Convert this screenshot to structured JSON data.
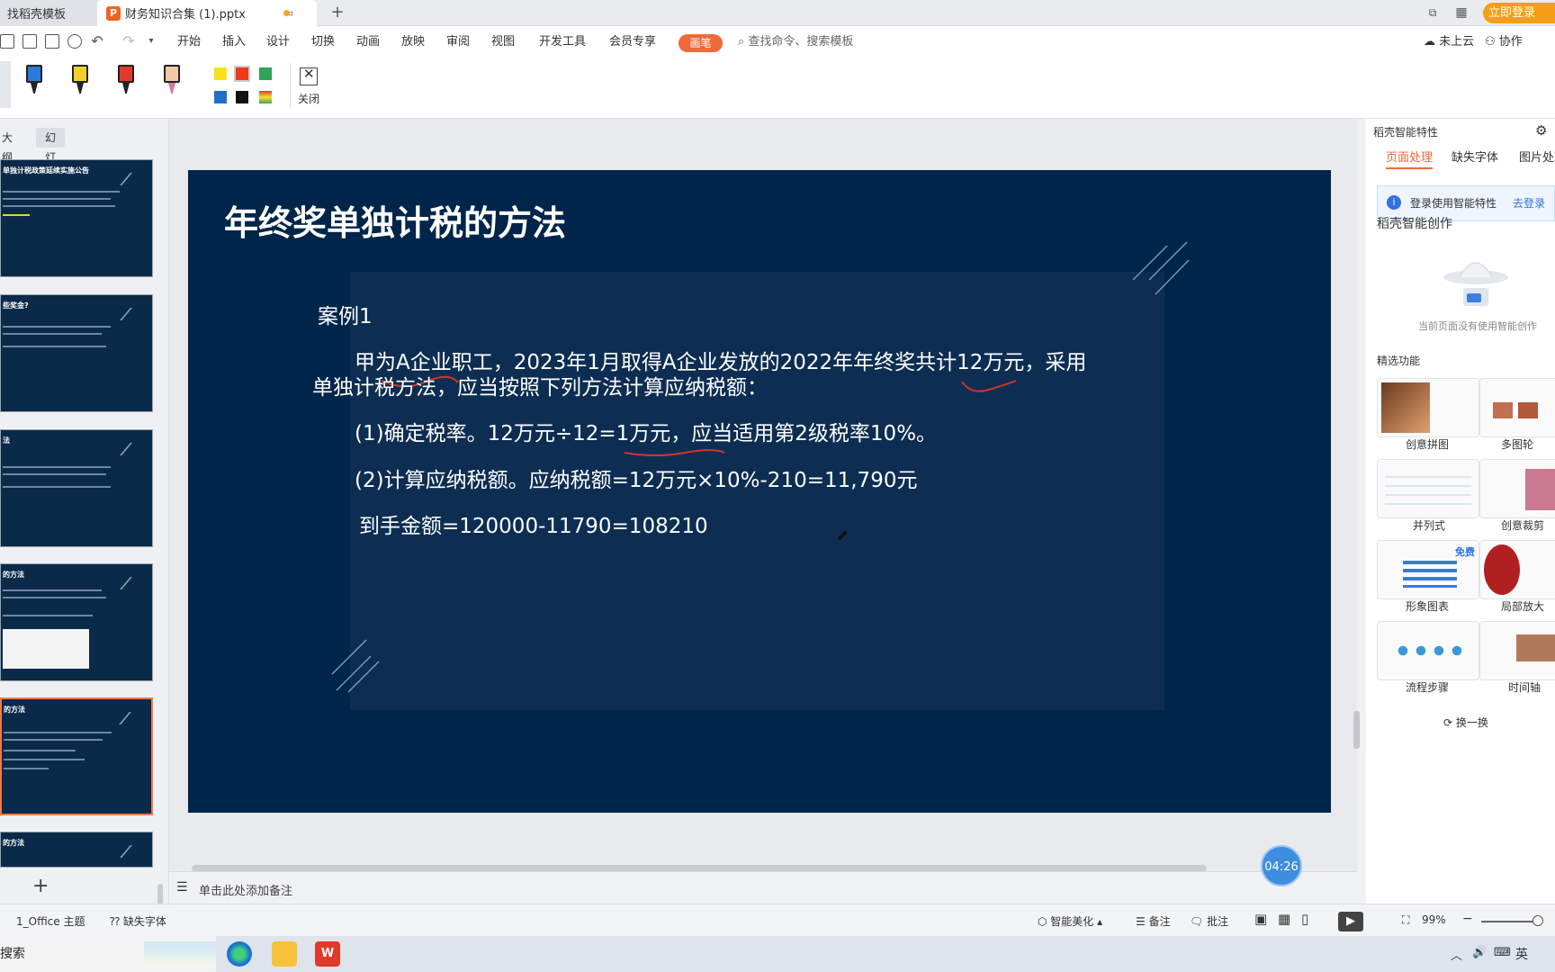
{
  "titlebar": {
    "tabs": [
      {
        "label": "找稻壳模板"
      },
      {
        "label": "财务知识合集 (1).pptx"
      }
    ],
    "login": "立即登录"
  },
  "menu": {
    "items": [
      "开始",
      "插入",
      "设计",
      "切换",
      "动画",
      "放映",
      "审阅",
      "视图",
      "开发工具",
      "会员专享"
    ],
    "pen": "画笔",
    "search_placeholder": "查找命令、搜索模板",
    "cloud": "未上云",
    "collab": "协作"
  },
  "ribbon": {
    "close": "关闭",
    "pen_colors": [
      "#2a7ad9",
      "#f2d02a",
      "#e03a2a",
      "#f3c9a4"
    ],
    "swatches": [
      "#f7e21a",
      "#f03a1a",
      "#2fa35a",
      "#1f6fc4",
      "#111111"
    ]
  },
  "left_panel": {
    "tabs": [
      "大纲",
      "幻灯片"
    ],
    "thumbs": [
      {
        "title": "单独计税政策延续实施公告"
      },
      {
        "title": "些奖金?"
      },
      {
        "title": "法"
      },
      {
        "title": "的方法"
      },
      {
        "title": "的方法"
      },
      {
        "title": "的方法"
      }
    ]
  },
  "slide": {
    "title": "年终奖单独计税的方法",
    "case": "案例1",
    "p1": "甲为A企业职工，2023年1月取得A企业发放的2022年年终奖共计12万元，采用",
    "p1b": "单独计税方法，应当按照下列方法计算应纳税额：",
    "p2": "(1)确定税率。12万元÷12=1万元，应当适用第2级税率10%。",
    "p3": "(2)计算应纳税额。应纳税额=12万元×10%-210=11,790元",
    "p4": "到手金额=120000-11790=108210"
  },
  "notes": "单击此处添加备注",
  "timer": "04:26",
  "right_panel": {
    "header": "稻壳智能特性",
    "tabs": [
      "页面处理",
      "缺失字体",
      "图片处理"
    ],
    "info": "登录使用智能特性",
    "info_link": "去登录",
    "section1": "稻壳智能创作",
    "empty": "当前页面没有使用智能创作",
    "section2": "精选功能",
    "features": [
      "创意拼图",
      "多图轮",
      "并列式",
      "创意裁剪",
      "形象图表",
      "局部放大",
      "流程步骤",
      "时间轴"
    ],
    "free_badge": "免费",
    "refresh": "换一换"
  },
  "status": {
    "theme": "1_Office 主题",
    "missing_font": "缺失字体",
    "beautify": "智能美化",
    "notes": "备注",
    "comment": "批注",
    "zoom": "99%"
  },
  "taskbar": {
    "search": "搜索",
    "ime": "英"
  }
}
